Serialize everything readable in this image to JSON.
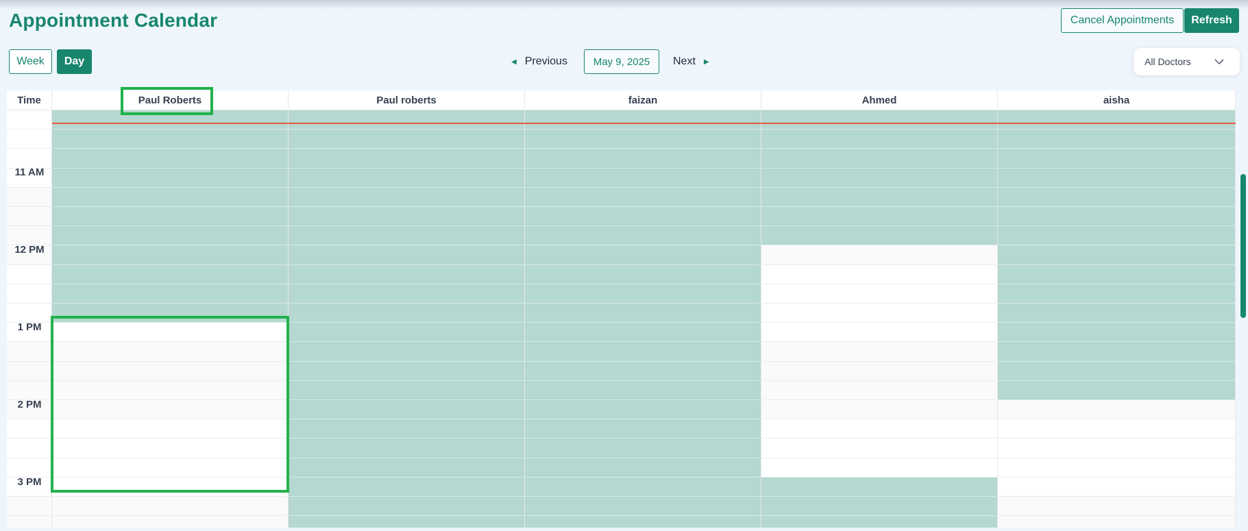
{
  "header": {
    "title": "Appointment Calendar",
    "cancel_label": "Cancel Appointments",
    "refresh_label": "Refresh"
  },
  "views": {
    "week_label": "Week",
    "day_label": "Day",
    "active": "Day"
  },
  "navigation": {
    "previous_label": "Previous",
    "date": "May 9, 2025",
    "next_label": "Next"
  },
  "doctor_filter": {
    "selected": "All Doctors"
  },
  "calendar": {
    "time_header": "Time",
    "doctors": [
      "Paul Roberts",
      "Paul roberts",
      "faizan",
      "Ahmed",
      "aisha"
    ],
    "time_labels": [
      "11 AM",
      "12 PM",
      "1 PM",
      "2 PM",
      "3 PM"
    ]
  },
  "colors": {
    "accent": "#17866d",
    "booked_slot": "#b5d8d0",
    "current_time_line": "#e4573d",
    "highlight_box": "#22b24c"
  }
}
